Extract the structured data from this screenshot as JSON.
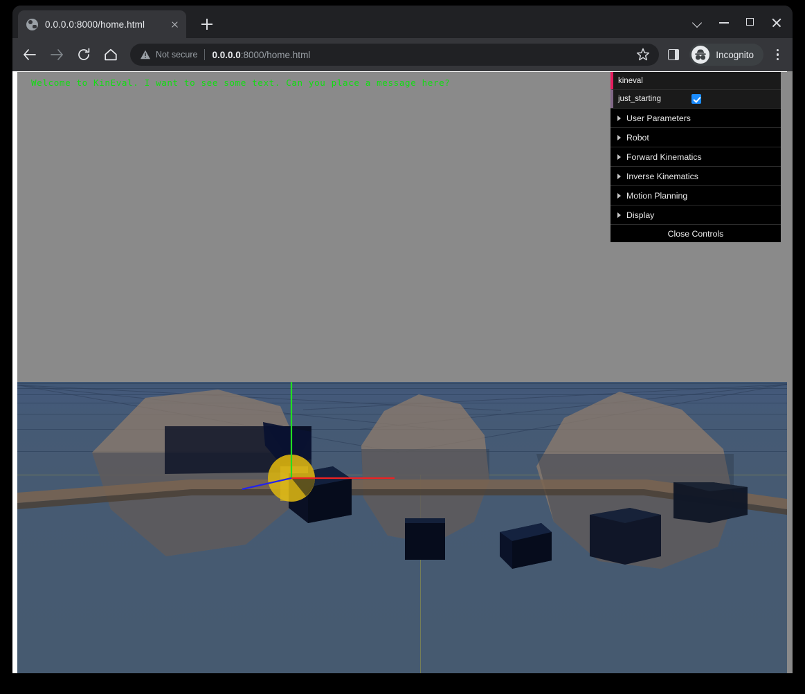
{
  "browser": {
    "tab": {
      "title": "0.0.0.0:8000/home.html",
      "favicon": "globe-icon",
      "close_icon": "close-icon"
    },
    "new_tab_icon": "plus-icon",
    "window_controls": {
      "tab_search_icon": "chevron-down-icon",
      "minimize_icon": "minimize-icon",
      "maximize_icon": "maximize-icon",
      "close_icon": "close-icon"
    },
    "toolbar": {
      "back_icon": "arrow-left-icon",
      "forward_icon": "arrow-right-icon",
      "reload_icon": "reload-icon",
      "home_icon": "home-icon",
      "security_label": "Not secure",
      "security_icon": "warning-triangle-icon",
      "url_bold": "0.0.0.0",
      "url_rest": ":8000/home.html",
      "url_full": "0.0.0.0:8000/home.html",
      "bookmark_icon": "star-icon",
      "side_panel_icon": "side-panel-icon",
      "profile_label": "Incognito",
      "profile_icon": "incognito-icon",
      "menu_icon": "three-dot-menu-icon"
    }
  },
  "page": {
    "overlay_message": "Welcome to KinEval. I want to see some text. Can you place a message here?",
    "overlay_color": "#12dd12"
  },
  "gui": {
    "title": "kineval",
    "toggle": {
      "label": "just_starting",
      "checked": true,
      "accent": "#1a8cff"
    },
    "folders": [
      {
        "label": "User Parameters"
      },
      {
        "label": "Robot"
      },
      {
        "label": "Forward Kinematics"
      },
      {
        "label": "Inverse Kinematics"
      },
      {
        "label": "Motion Planning"
      },
      {
        "label": "Display"
      }
    ],
    "close_label": "Close Controls",
    "title_accent": "#e61d5f",
    "toggle_accent": "#806787"
  },
  "scene": {
    "sky_color": "#8a8a8a",
    "ground_color": "#465a72",
    "rock_color": "#8f7c6c",
    "link_color": "#0a1024",
    "joint_color": "#d4af13",
    "axis_x_color": "#ee2222",
    "axis_y_color": "#22dd22",
    "axis_z_color": "#2222ee",
    "grid_color": "#96964a"
  }
}
